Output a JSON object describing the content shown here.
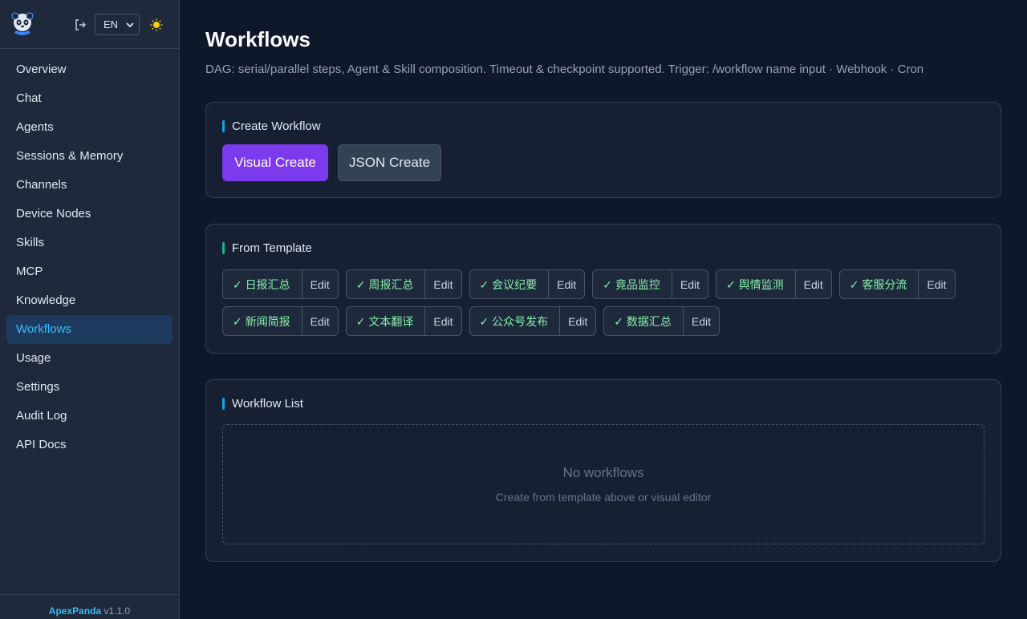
{
  "sidebar": {
    "lang": "EN",
    "nav": [
      {
        "label": "Overview"
      },
      {
        "label": "Chat"
      },
      {
        "label": "Agents"
      },
      {
        "label": "Sessions & Memory"
      },
      {
        "label": "Channels"
      },
      {
        "label": "Device Nodes"
      },
      {
        "label": "Skills"
      },
      {
        "label": "MCP"
      },
      {
        "label": "Knowledge"
      },
      {
        "label": "Workflows",
        "active": true
      },
      {
        "label": "Usage"
      },
      {
        "label": "Settings"
      },
      {
        "label": "Audit Log"
      },
      {
        "label": "API Docs"
      }
    ],
    "footer": {
      "brand": "ApexPanda",
      "version": "v1.1.0"
    }
  },
  "main": {
    "title": "Workflows",
    "description": "DAG: serial/parallel steps, Agent & Skill composition. Timeout & checkpoint supported. Trigger: /workflow name input · Webhook · Cron",
    "create": {
      "title": "Create Workflow",
      "visual_label": "Visual Create",
      "json_label": "JSON Create"
    },
    "templates": {
      "title": "From Template",
      "edit_label": "Edit",
      "items": [
        "✓ 日报汇总",
        "✓ 周报汇总",
        "✓ 会议纪要",
        "✓ 竟品监控",
        "✓ 舆情监测",
        "✓ 客服分流",
        "✓ 新闻简报",
        "✓ 文本翻译",
        "✓ 公众号发布",
        "✓ 数据汇总"
      ]
    },
    "list": {
      "title": "Workflow List",
      "empty_title": "No workflows",
      "empty_sub": "Create from template above or visual editor"
    }
  },
  "colors": {
    "accent_blue": "#38bdf8",
    "primary_purple": "#7c3aed",
    "template_green": "#86efac",
    "bar_blue": "#0ea5e9",
    "bar_green": "#10b981"
  }
}
